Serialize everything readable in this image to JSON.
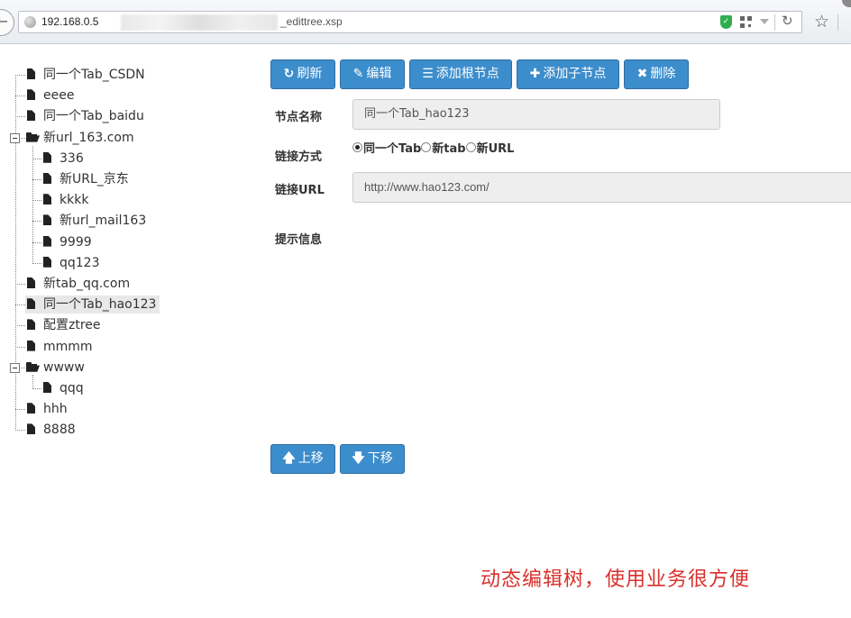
{
  "browser": {
    "url_prefix": "192.168.0.5",
    "url_suffix": "_edittree.xsp"
  },
  "tree": {
    "nodes": [
      {
        "label": "同一个Tab_CSDN",
        "type": "file",
        "level": 0
      },
      {
        "label": "eeee",
        "type": "file",
        "level": 0
      },
      {
        "label": "同一个Tab_baidu",
        "type": "file",
        "level": 0
      },
      {
        "label": "新url_163.com",
        "type": "folder",
        "level": 0,
        "expanded": true
      },
      {
        "label": "336",
        "type": "file",
        "level": 1
      },
      {
        "label": "新URL_京东",
        "type": "file",
        "level": 1
      },
      {
        "label": "kkkk",
        "type": "file",
        "level": 1
      },
      {
        "label": "新url_mail163",
        "type": "file",
        "level": 1
      },
      {
        "label": "9999",
        "type": "file",
        "level": 1
      },
      {
        "label": "qq123",
        "type": "file",
        "level": 1
      },
      {
        "label": "新tab_qq.com",
        "type": "file",
        "level": 0
      },
      {
        "label": "同一个Tab_hao123",
        "type": "file",
        "level": 0,
        "selected": true
      },
      {
        "label": "配置ztree",
        "type": "file",
        "level": 0
      },
      {
        "label": "mmmm",
        "type": "file",
        "level": 0
      },
      {
        "label": "wwww",
        "type": "folder",
        "level": 0,
        "expanded": true
      },
      {
        "label": "qqq",
        "type": "file",
        "level": 1
      },
      {
        "label": "hhh",
        "type": "file",
        "level": 0
      },
      {
        "label": "8888",
        "type": "file",
        "level": 0
      }
    ]
  },
  "toolbar": {
    "refresh": "刷新",
    "edit": "编辑",
    "add_root": "添加根节点",
    "add_child": "添加子节点",
    "delete": "删除"
  },
  "form": {
    "node_name_label": "节点名称",
    "node_name_value": "同一个Tab_hao123",
    "link_mode_label": "链接方式",
    "link_options": [
      "同一个Tab",
      "新tab",
      "新URL"
    ],
    "link_selected": 0,
    "link_url_label": "链接URL",
    "link_url_value": "http://www.hao123.com/",
    "hint_label": "提示信息",
    "hint_value": ""
  },
  "move": {
    "up": "上移",
    "down": "下移"
  },
  "caption": "动态编辑树，使用业务很方便",
  "colors": {
    "button_bg": "#3c8dcc",
    "button_border": "#2e6da4",
    "caption": "#d9302c",
    "selected_node_bg": "#e8e8e8"
  }
}
